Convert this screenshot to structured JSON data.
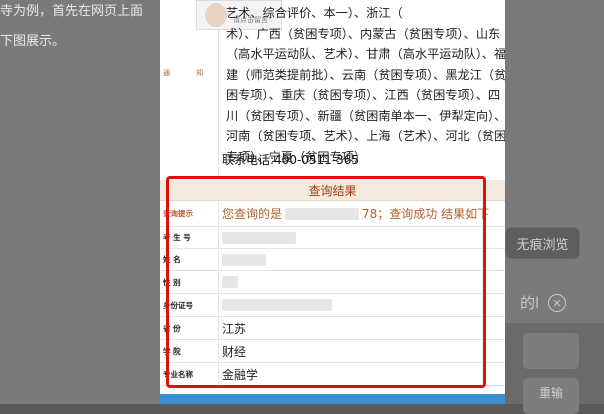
{
  "background": {
    "text_line1": "寺为例，首先在网页上面",
    "text_line2": "下图展示。",
    "right_button": "无痕浏览",
    "right_word": "的l",
    "right_key_label": "重输"
  },
  "notice": {
    "label": "通 知",
    "avatar_caption": "请点击留言",
    "lines": [
      "艺术、综合评价、本一）、浙江（",
      "术）、广西（贫困专项）、内蒙古（贫困专项）、山东",
      "（高水平运动队、艺术）、甘肃（高水平运动队）、福",
      "建（师范类提前批）、云南（贫困专项）、黑龙江（贫",
      "困专项）、重庆（贫困专项）、江西（贫困专项）、四",
      "川（贫困专项）、新疆（贫困南单本一、伊犁定向）、",
      "河南（贫困专项、艺术）、上海（艺术）、河北（贫困",
      "专项）、宁夏（贫困专项）"
    ],
    "phone": "联系电话:400-0511-365"
  },
  "result": {
    "title": "查询结果",
    "hint_label": "查询提示",
    "hint_prefix": "您查询的是",
    "hint_suffix": "78；查询成功 结果如下",
    "rows": [
      {
        "label": "考 生 号",
        "value": ""
      },
      {
        "label": "姓    名",
        "value": ""
      },
      {
        "label": "性    别",
        "value": ""
      },
      {
        "label": "身份证号",
        "value": ""
      },
      {
        "label": "省    份",
        "value": "江苏"
      },
      {
        "label": "学    院",
        "value": "财经"
      },
      {
        "label": "专业名称",
        "value": "金融学"
      }
    ]
  },
  "colors": {
    "highlight_frame": "#e01010",
    "accent_orange": "#b3602f",
    "title_bg": "#f3e9dc"
  }
}
